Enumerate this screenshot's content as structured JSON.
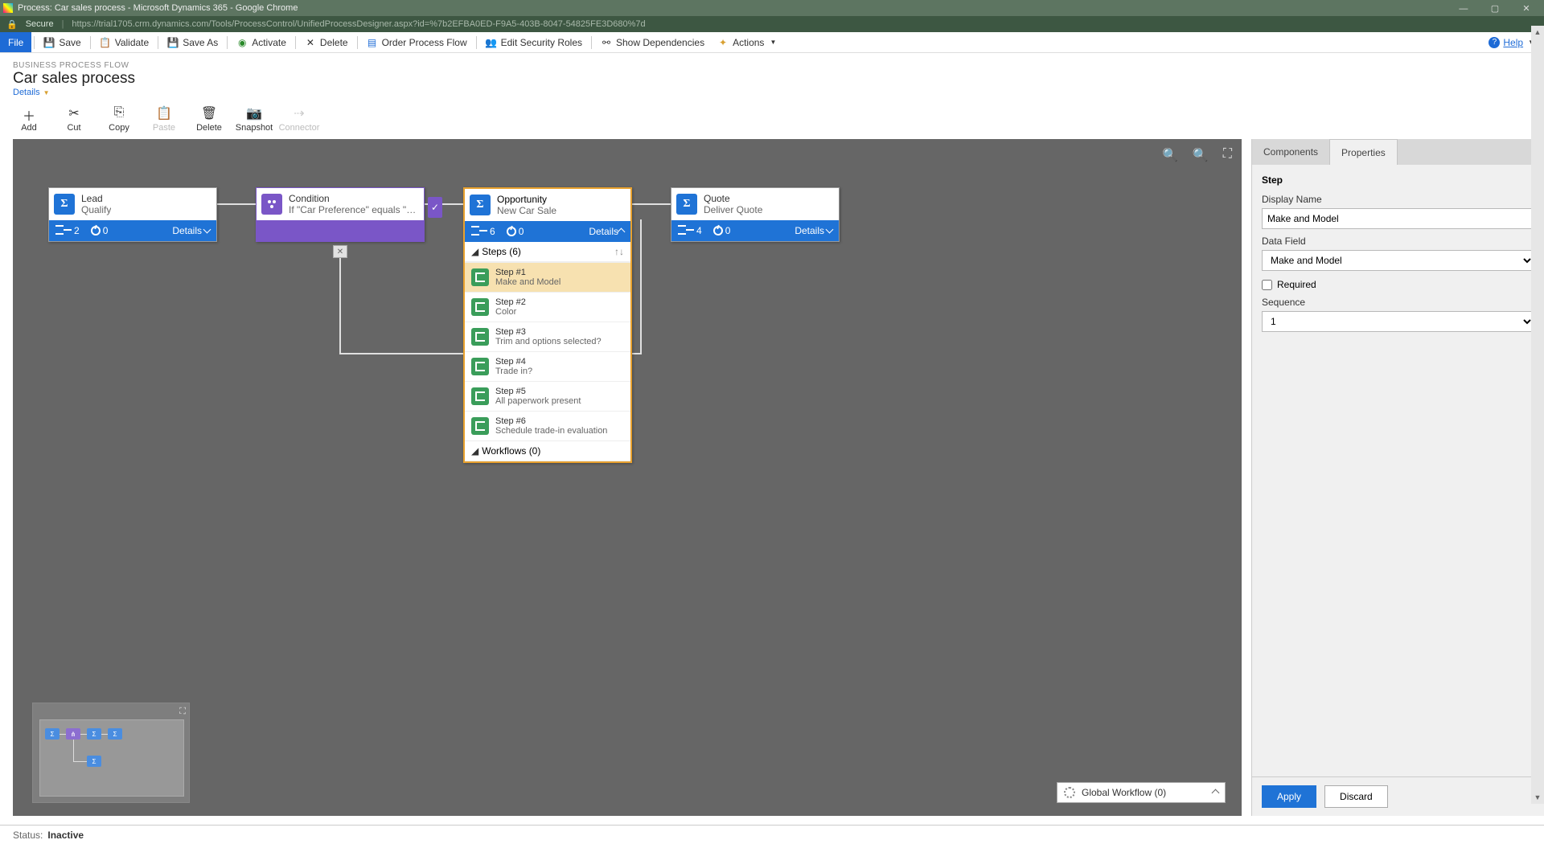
{
  "window": {
    "title": "Process: Car sales process - Microsoft Dynamics 365 - Google Chrome"
  },
  "address": {
    "secure": "Secure",
    "url": "https://trial1705.crm.dynamics.com/Tools/ProcessControl/UnifiedProcessDesigner.aspx?id=%7b2EFBA0ED-F9A5-403B-8047-54825FE3D680%7d"
  },
  "cmdbar": {
    "file": "File",
    "save": "Save",
    "validate": "Validate",
    "saveas": "Save As",
    "activate": "Activate",
    "delete": "Delete",
    "order": "Order Process Flow",
    "editsec": "Edit Security Roles",
    "showdep": "Show Dependencies",
    "actions": "Actions",
    "help": "Help"
  },
  "header": {
    "crumb": "BUSINESS PROCESS FLOW",
    "title": "Car sales process",
    "details": "Details"
  },
  "actions": {
    "add": "Add",
    "cut": "Cut",
    "copy": "Copy",
    "paste": "Paste",
    "delete": "Delete",
    "snapshot": "Snapshot",
    "connector": "Connector"
  },
  "nodes": {
    "lead": {
      "title": "Lead",
      "sub": "Qualify",
      "count1": "2",
      "count2": "0",
      "details": "Details"
    },
    "condition": {
      "title": "Condition",
      "sub": "If \"Car Preference\" equals \"New ..."
    },
    "opportunity": {
      "title": "Opportunity",
      "sub": "New Car Sale",
      "count1": "6",
      "count2": "0",
      "details": "Details"
    },
    "quote": {
      "title": "Quote",
      "sub": "Deliver Quote",
      "count1": "4",
      "count2": "0",
      "details": "Details"
    }
  },
  "oppSteps": {
    "stepsHeader": "Steps (6)",
    "workflowsHeader": "Workflows (0)",
    "items": [
      {
        "num": "Step #1",
        "label": "Make and Model"
      },
      {
        "num": "Step #2",
        "label": "Color"
      },
      {
        "num": "Step #3",
        "label": "Trim and options selected?"
      },
      {
        "num": "Step #4",
        "label": "Trade in?"
      },
      {
        "num": "Step #5",
        "label": "All paperwork present"
      },
      {
        "num": "Step #6",
        "label": "Schedule trade-in evaluation"
      }
    ]
  },
  "globalWorkflow": "Global Workflow (0)",
  "propPanel": {
    "tabComponents": "Components",
    "tabProperties": "Properties",
    "group": "Step",
    "displayNameLabel": "Display Name",
    "displayNameValue": "Make and Model",
    "dataFieldLabel": "Data Field",
    "dataFieldValue": "Make and Model",
    "requiredLabel": "Required",
    "sequenceLabel": "Sequence",
    "sequenceValue": "1",
    "apply": "Apply",
    "discard": "Discard"
  },
  "status": {
    "label": "Status:",
    "value": "Inactive"
  }
}
